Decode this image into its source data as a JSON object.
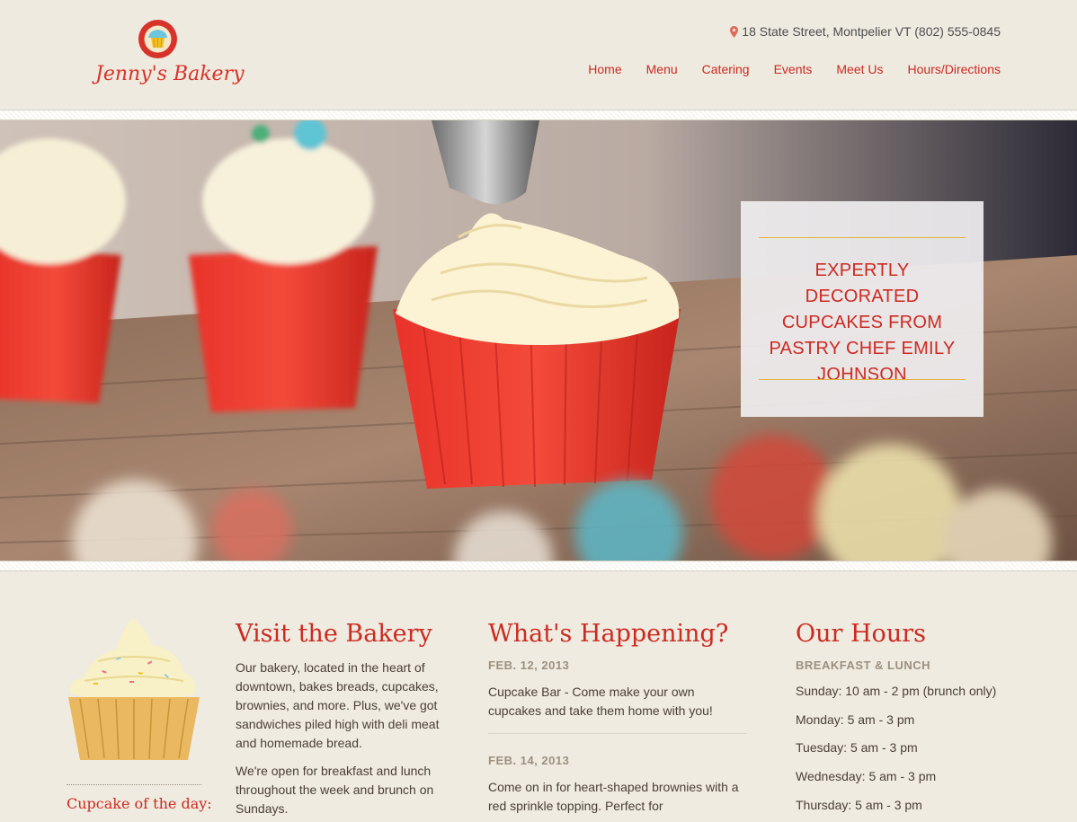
{
  "header": {
    "logo_text": "Jenny's Bakery",
    "address": "18 State Street, Montpelier VT (802) 555-0845",
    "nav": [
      "Home",
      "Menu",
      "Catering",
      "Events",
      "Meet Us",
      "Hours/Directions"
    ]
  },
  "hero": {
    "title": "Expertly decorated cupcakes from pastry chef Emily Johnson"
  },
  "sidebar": {
    "cupcake_label": "Cupcake of the day:"
  },
  "visit": {
    "heading": "Visit the Bakery",
    "paragraphs": [
      "Our bakery, located in the heart of downtown, bakes breads, cupcakes, brownies, and more. Plus, we've got sandwiches piled high with deli meat and homemade bread.",
      "We're open for breakfast and lunch throughout the week and brunch on Sundays."
    ]
  },
  "happening": {
    "heading": "What's Happening?",
    "events": [
      {
        "date": "Feb. 12, 2013",
        "text": "Cupcake Bar - Come make your own cupcakes and take them home with you!"
      },
      {
        "date": "Feb. 14, 2013",
        "text": "Come on in for heart-shaped brownies with a red sprinkle topping. Perfect for"
      }
    ]
  },
  "hours": {
    "heading": "Our Hours",
    "subheading": "Breakfast & Lunch",
    "rows": [
      "Sunday: 10 am - 2 pm (brunch only)",
      "Monday: 5 am - 3 pm",
      "Tuesday: 5 am - 3 pm",
      "Wednesday: 5 am - 3 pm",
      "Thursday: 5 am - 3 pm"
    ]
  },
  "colors": {
    "accent": "#cc2a21",
    "background": "#efebe0",
    "gold": "#e1b43c"
  },
  "icons": [
    "map-pin-icon",
    "cupcake-logo-icon"
  ]
}
